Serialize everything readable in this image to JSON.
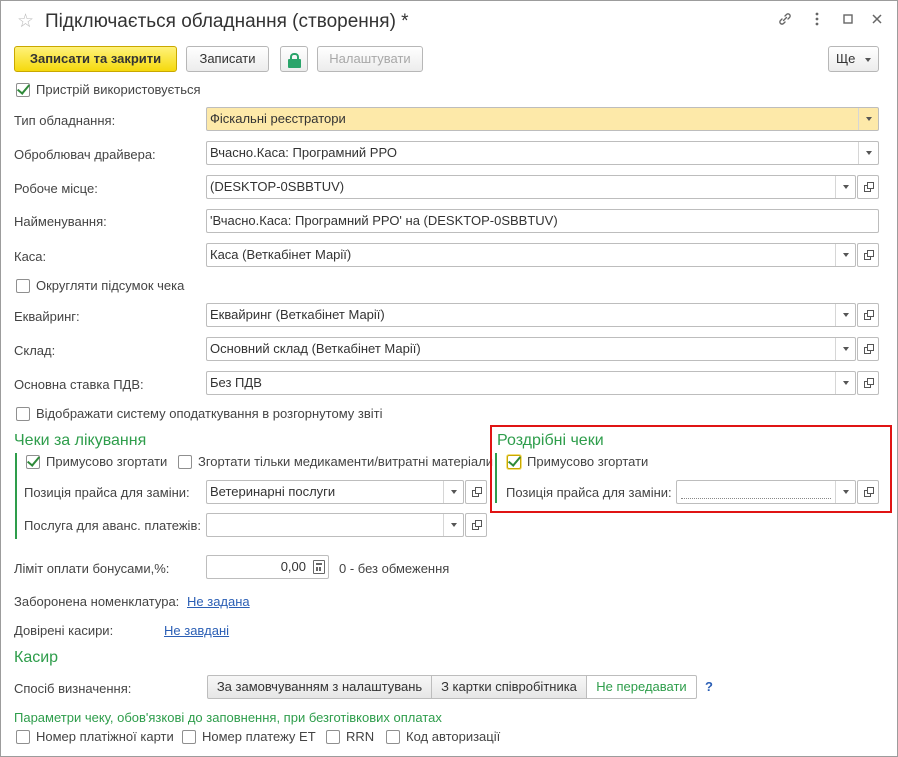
{
  "title": "Підключається обладнання (створення) *",
  "toolbar": {
    "save_close": "Записати та закрити",
    "save": "Записати",
    "configure": "Налаштувати",
    "more": "Ще"
  },
  "device_used": {
    "label": "Пристрій використовується",
    "checked": true
  },
  "fields": {
    "equipment_type": {
      "label": "Тип обладнання:",
      "value": "Фіскальні реєстратори"
    },
    "driver_handler": {
      "label": "Оброблювач драйвера:",
      "value": "Вчасно.Каса: Програмний РРО"
    },
    "workplace": {
      "label": "Робоче місце:",
      "value": "(DESKTOP-0SBBTUV)"
    },
    "name": {
      "label": "Найменування:",
      "value": "'Вчасно.Каса: Програмний РРО' на (DESKTOP-0SBBTUV)"
    },
    "cash": {
      "label": "Каса:",
      "value": "Каса (Веткабінет Марії)"
    },
    "acquiring": {
      "label": "Еквайринг:",
      "value": "Еквайринг (Веткабінет Марії)"
    },
    "warehouse": {
      "label": "Склад:",
      "value": "Основний склад (Веткабінет Марії)"
    },
    "vat_rate": {
      "label": "Основна ставка ПДВ:",
      "value": "Без ПДВ"
    }
  },
  "round_total": {
    "label": "Округляти підсумок чека",
    "checked": false
  },
  "show_tax_system": {
    "label": "Відображати систему оподаткування в розгорнутому звіті",
    "checked": false
  },
  "treatment_checks": {
    "title": "Чеки за лікування",
    "force_collapse": {
      "label": "Примусово згортати",
      "checked": true
    },
    "collapse_meds": {
      "label": "Згортати тільки медикаменти/витратні матеріали",
      "checked": false
    },
    "price_position": {
      "label": "Позиція прайса для заміни:",
      "value": "Ветеринарні послуги"
    },
    "advance_service": {
      "label": "Послуга для аванс. платежів:",
      "value": ""
    }
  },
  "retail_checks": {
    "title": "Роздрібні чеки",
    "force_collapse": {
      "label": "Примусово згортати",
      "checked": true
    },
    "price_position": {
      "label": "Позиція прайса для заміни:",
      "value": ""
    }
  },
  "bonus_limit": {
    "label": "Ліміт оплати бонусами,%:",
    "value": "0,00",
    "note": "0 - без обмеження"
  },
  "forbidden_nomenclature": {
    "label": "Заборонена номенклатура:",
    "link": "Не задана"
  },
  "trusted_cashiers": {
    "label": "Довірені касири:",
    "link": "Не завдані"
  },
  "cashier": {
    "title": "Касир",
    "method_label": "Спосіб визначення:",
    "options": [
      "За замовчуванням з налаштувань",
      "З картки співробітника",
      "Не передавати"
    ],
    "selected": "Не передавати",
    "help": "?"
  },
  "check_params": {
    "title": "Параметри чеку, обов'язкові до заповнення, при безготівкових оплатах",
    "items": [
      {
        "label": "Номер платіжної карти",
        "checked": false
      },
      {
        "label": "Номер платежу ЕТ",
        "checked": false
      },
      {
        "label": "RRN",
        "checked": false
      },
      {
        "label": "Код авторизації",
        "checked": false
      }
    ]
  },
  "icons": [
    "star-icon",
    "link-icon",
    "menu-dots-icon",
    "maximize-icon",
    "close-icon",
    "lock-icon",
    "calculator-icon"
  ],
  "colors": {
    "accent_green": "#2e9d4b",
    "primary_yellow": "#f5d90d",
    "highlight_red": "#e01414",
    "link_blue": "#2b5fb5"
  }
}
